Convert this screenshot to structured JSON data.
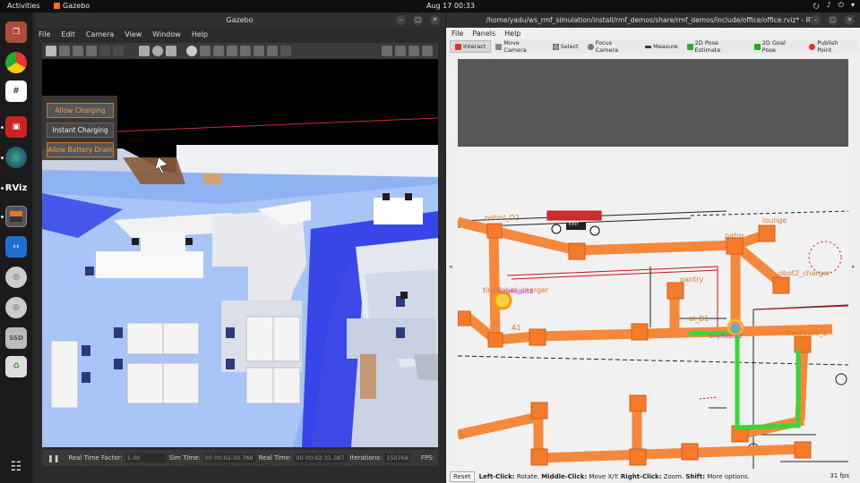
{
  "topbar": {
    "activities": "Activities",
    "app": "Gazebo",
    "clock": "Aug 17  00:33"
  },
  "gazebo": {
    "title": "Gazebo",
    "menu": [
      "File",
      "Edit",
      "Camera",
      "View",
      "Window",
      "Help"
    ],
    "overlay": {
      "allow_charging": "Allow Charging",
      "instant_charging": "Instant Charging",
      "allow_battery_drain": "Allow Battery Drain"
    },
    "status": {
      "real_time_factor_label": "Real Time Factor:",
      "real_time_factor_value": "1.00",
      "sim_time_label": "Sim Time:",
      "sim_time_value": "00 00:02:30.768",
      "real_time_label": "Real Time:",
      "real_time_value": "00 00:02:31.387",
      "iterations_label": "Iterations:",
      "iterations_value": "150768",
      "fps_label": "FPS:"
    }
  },
  "rviz": {
    "title": "/home/yadu/ws_rmf_simulation/install/rmf_demos/share/rmf_demos/include/office/office.rviz* - RViz",
    "menu": [
      "File",
      "Panels",
      "Help"
    ],
    "tools": [
      "Interact",
      "Move Camera",
      "Select",
      "Focus Camera",
      "Measure",
      "2D Pose Estimate",
      "2D Goal Pose",
      "Publish Point"
    ],
    "map_labels": {
      "patrol_d2": "patrol_D2",
      "exit": "EXIT",
      "lounge": "lounge",
      "patrol_a": "patro",
      "tinyrobot_charger": "tinyRobot_charger",
      "tinyrobot1": "tinyRobot1",
      "pantry": "pantry",
      "tinyrobot2_charger": "obot2_charger",
      "a1": "A1",
      "patrol_d1": "ol_D1",
      "tinyrobot2": "tinyRobot2",
      "hardware_2": "hardware_2",
      "b": "B"
    },
    "bottom": {
      "reset": "Reset",
      "left_click": "Left-Click:",
      "left_action": "Rotate.",
      "middle_click": "Middle-Click:",
      "middle_action": "Move X/Y.",
      "right_click": "Right-Click:",
      "right_action": "Zoom.",
      "shift": "Shift:",
      "shift_action": "More options.",
      "fps": "31 fps"
    }
  },
  "colors": {
    "route": "#f5883a",
    "path": "#3fdc3f",
    "floor": "#7aa7f5",
    "lane_blue": "#2030e0"
  }
}
